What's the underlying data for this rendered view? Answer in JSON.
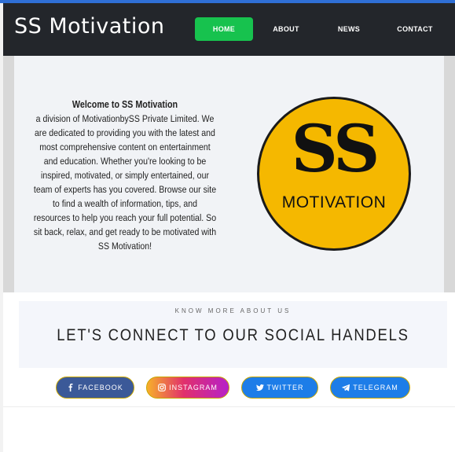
{
  "brand": {
    "title": "SS Motivation"
  },
  "nav": {
    "items": [
      {
        "label": "HOME"
      },
      {
        "label": "ABOUT"
      },
      {
        "label": "NEWS"
      },
      {
        "label": "CONTACT"
      }
    ],
    "active": "HOME"
  },
  "hero": {
    "title": "Welcome to SS Motivation",
    "body": "a division of MotivationbySS Private Limited. We are dedicated to providing you with the latest and most comprehensive content on entertainment and education. Whether you're looking to be inspired, motivated, or simply entertained, our team of experts has you covered. Browse our site to find a wealth of information, tips, and resources to help you reach your full potential. So sit back, relax, and get ready to be motivated with SS Motivation!",
    "logo": {
      "main": "SS",
      "sub": "MOTIVATION"
    }
  },
  "connect": {
    "eyebrow": "KNOW MORE ABOUT US",
    "title": "LET'S CONNECT TO OUR SOCIAL HANDELS"
  },
  "social": [
    {
      "label": "FACEBOOK",
      "icon": "facebook-icon",
      "color": "#3b5998"
    },
    {
      "label": "INSTAGRAM",
      "icon": "instagram-icon",
      "color": "#e1306c"
    },
    {
      "label": "TWITTER",
      "icon": "twitter-icon",
      "color": "#1d7de8"
    },
    {
      "label": "TELEGRAM",
      "icon": "telegram-icon",
      "color": "#1d7de8"
    }
  ],
  "colors": {
    "navbar": "#23262b",
    "accent": "#17c24e",
    "top_line": "#2f6fd6",
    "logo_yellow": "#f5b800"
  }
}
